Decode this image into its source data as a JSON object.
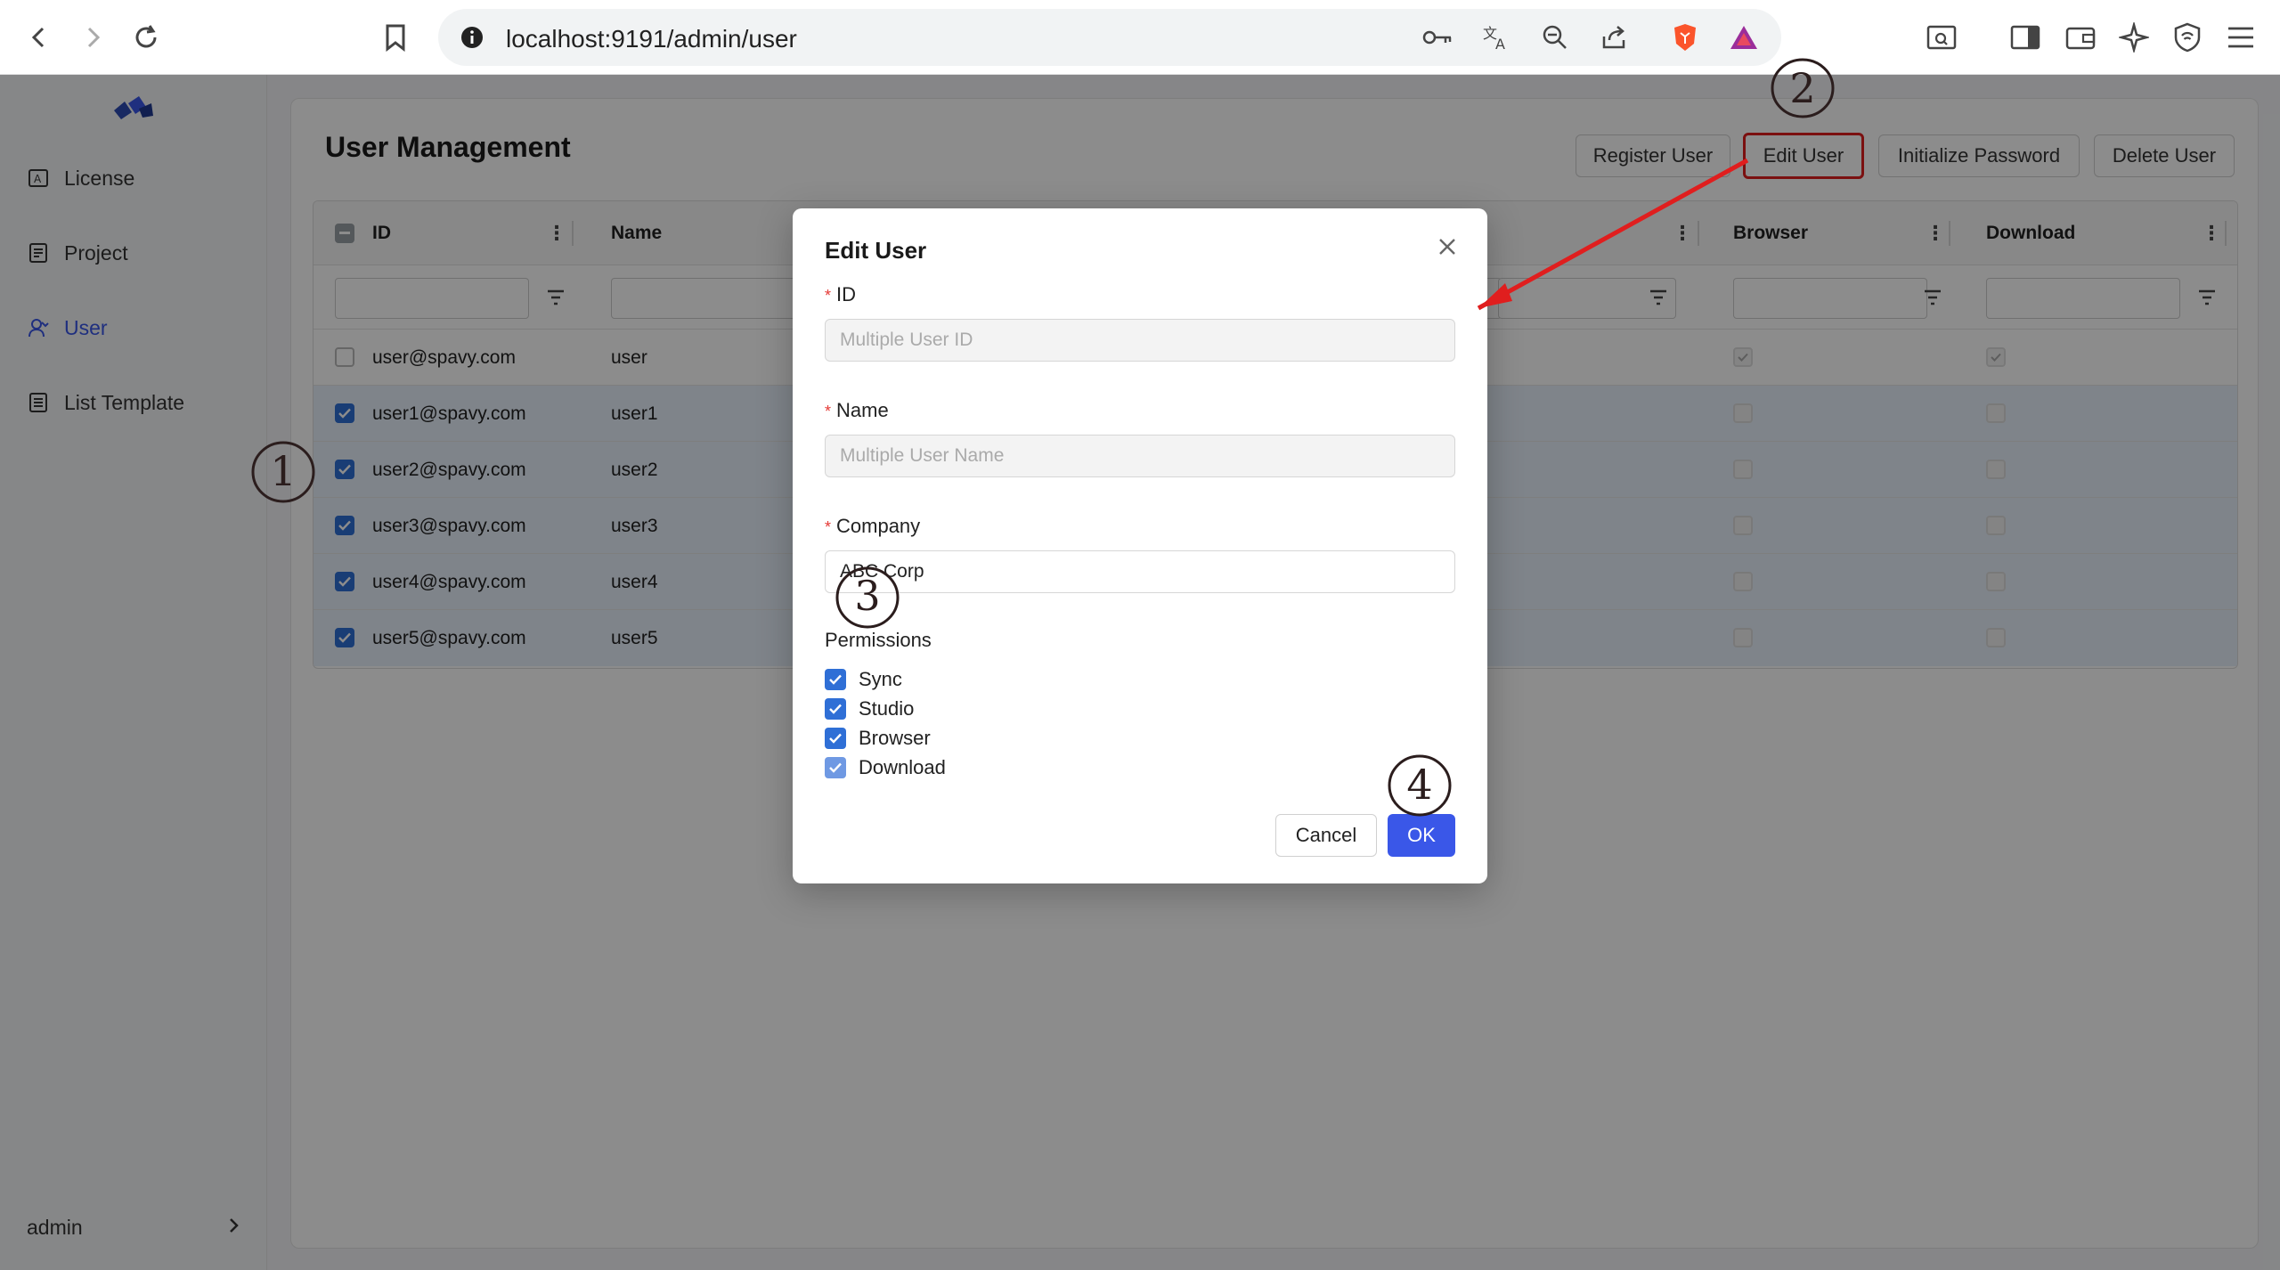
{
  "browser": {
    "url": "localhost:9191/admin/user"
  },
  "sidebar": {
    "items": [
      {
        "label": "License",
        "icon": "license-icon"
      },
      {
        "label": "Project",
        "icon": "project-icon"
      },
      {
        "label": "User",
        "icon": "user-icon"
      },
      {
        "label": "List Template",
        "icon": "list-template-icon"
      }
    ],
    "active": "User",
    "user_label": "admin"
  },
  "main": {
    "title": "User Management",
    "actions": {
      "register": "Register User",
      "edit": "Edit User",
      "init_password": "Initialize Password",
      "delete": "Delete User"
    },
    "columns": [
      "ID",
      "Name",
      "Browser",
      "Download"
    ],
    "rows": [
      {
        "id": "user@spavy.com",
        "name": "user",
        "selected": false
      },
      {
        "id": "user1@spavy.com",
        "name": "user1",
        "selected": true
      },
      {
        "id": "user2@spavy.com",
        "name": "user2",
        "selected": true
      },
      {
        "id": "user3@spavy.com",
        "name": "user3",
        "selected": true
      },
      {
        "id": "user4@spavy.com",
        "name": "user4",
        "selected": true
      },
      {
        "id": "user5@spavy.com",
        "name": "user5",
        "selected": true
      }
    ]
  },
  "modal": {
    "title": "Edit User",
    "id_label": "ID",
    "id_placeholder": "Multiple User ID",
    "name_label": "Name",
    "name_placeholder": "Multiple User Name",
    "company_label": "Company",
    "company_value": "ABC Corp",
    "permissions_label": "Permissions",
    "permissions": [
      "Sync",
      "Studio",
      "Browser",
      "Download"
    ],
    "cancel": "Cancel",
    "ok": "OK"
  },
  "annotations": {
    "step1": "1",
    "step2": "2",
    "step3": "3",
    "step4": "4",
    "color": "#e01e1e"
  },
  "colors": {
    "accent": "#3a57e8",
    "checkbox": "#2f6fd6",
    "selected_row": "#e8f0fb"
  }
}
